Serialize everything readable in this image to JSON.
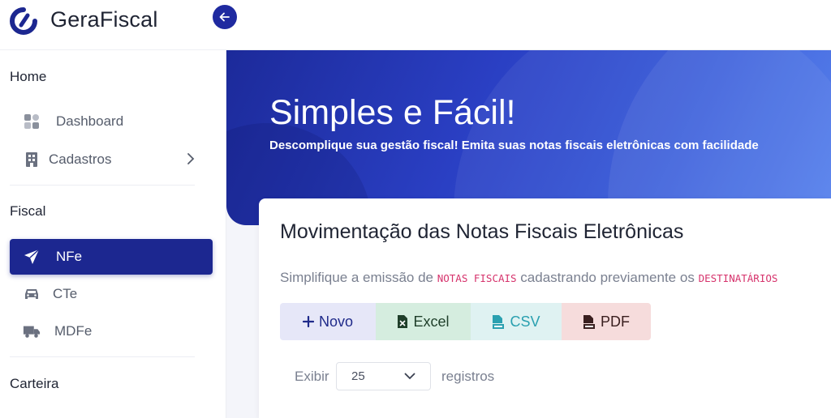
{
  "app": {
    "brand": "GeraFiscal"
  },
  "sidebar": {
    "sections": [
      {
        "title": "Home"
      },
      {
        "title": "Fiscal"
      },
      {
        "title": "Carteira"
      }
    ],
    "items": [
      {
        "label": "Dashboard",
        "icon": "dashboard-icon"
      },
      {
        "label": "Cadastros",
        "icon": "building-icon"
      },
      {
        "label": "NFe",
        "icon": "paper-plane-icon",
        "active": true
      },
      {
        "label": "CTe",
        "icon": "car-icon"
      },
      {
        "label": "MDFe",
        "icon": "truck-icon"
      }
    ]
  },
  "hero": {
    "title": "Simples e Fácil!",
    "subtitle": "Descomplique sua gestão fiscal! Emita suas notas fiscais eletrônicas com facilidade"
  },
  "card": {
    "title": "Movimentação das Notas Fiscais Eletrônicas",
    "desc_prefix": "Simplifique a emissão de",
    "desc_code1": "NOTAS FISCAIS",
    "desc_middle": "cadastrando previamente os",
    "desc_code2": "DESTINATÁRIOS",
    "buttons": {
      "novo": "Novo",
      "excel": "Excel",
      "csv": "CSV",
      "pdf": "PDF"
    },
    "length": {
      "show_label": "Exibir",
      "value": "25",
      "records_label": "registros"
    }
  },
  "colors": {
    "primary": "#1c2790",
    "hero_start": "#1c2a9a",
    "hero_end": "#4a78ec",
    "code": "#d6336c"
  }
}
